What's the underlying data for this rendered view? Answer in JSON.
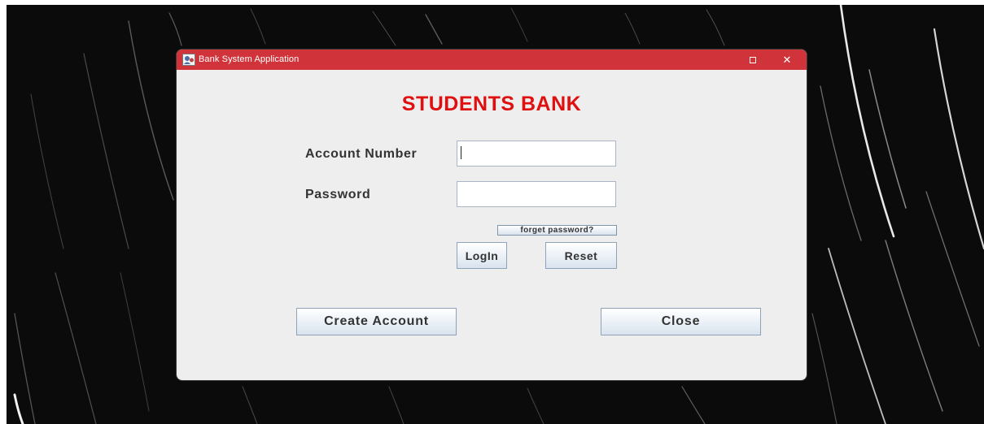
{
  "window": {
    "title": "Bank System Application",
    "maximize_icon": "maximize-icon",
    "close_symbol": "✕",
    "titlebar_color": "#d0343a"
  },
  "form": {
    "heading": "STUDENTS BANK",
    "heading_color": "#e01010",
    "account_number_label": "Account Number",
    "account_number_value": "",
    "password_label": "Password",
    "password_value": ""
  },
  "buttons": {
    "forget_password": "forget password?",
    "login": "LogIn",
    "reset": "Reset",
    "create_account": "Create Account",
    "close": "Close"
  }
}
